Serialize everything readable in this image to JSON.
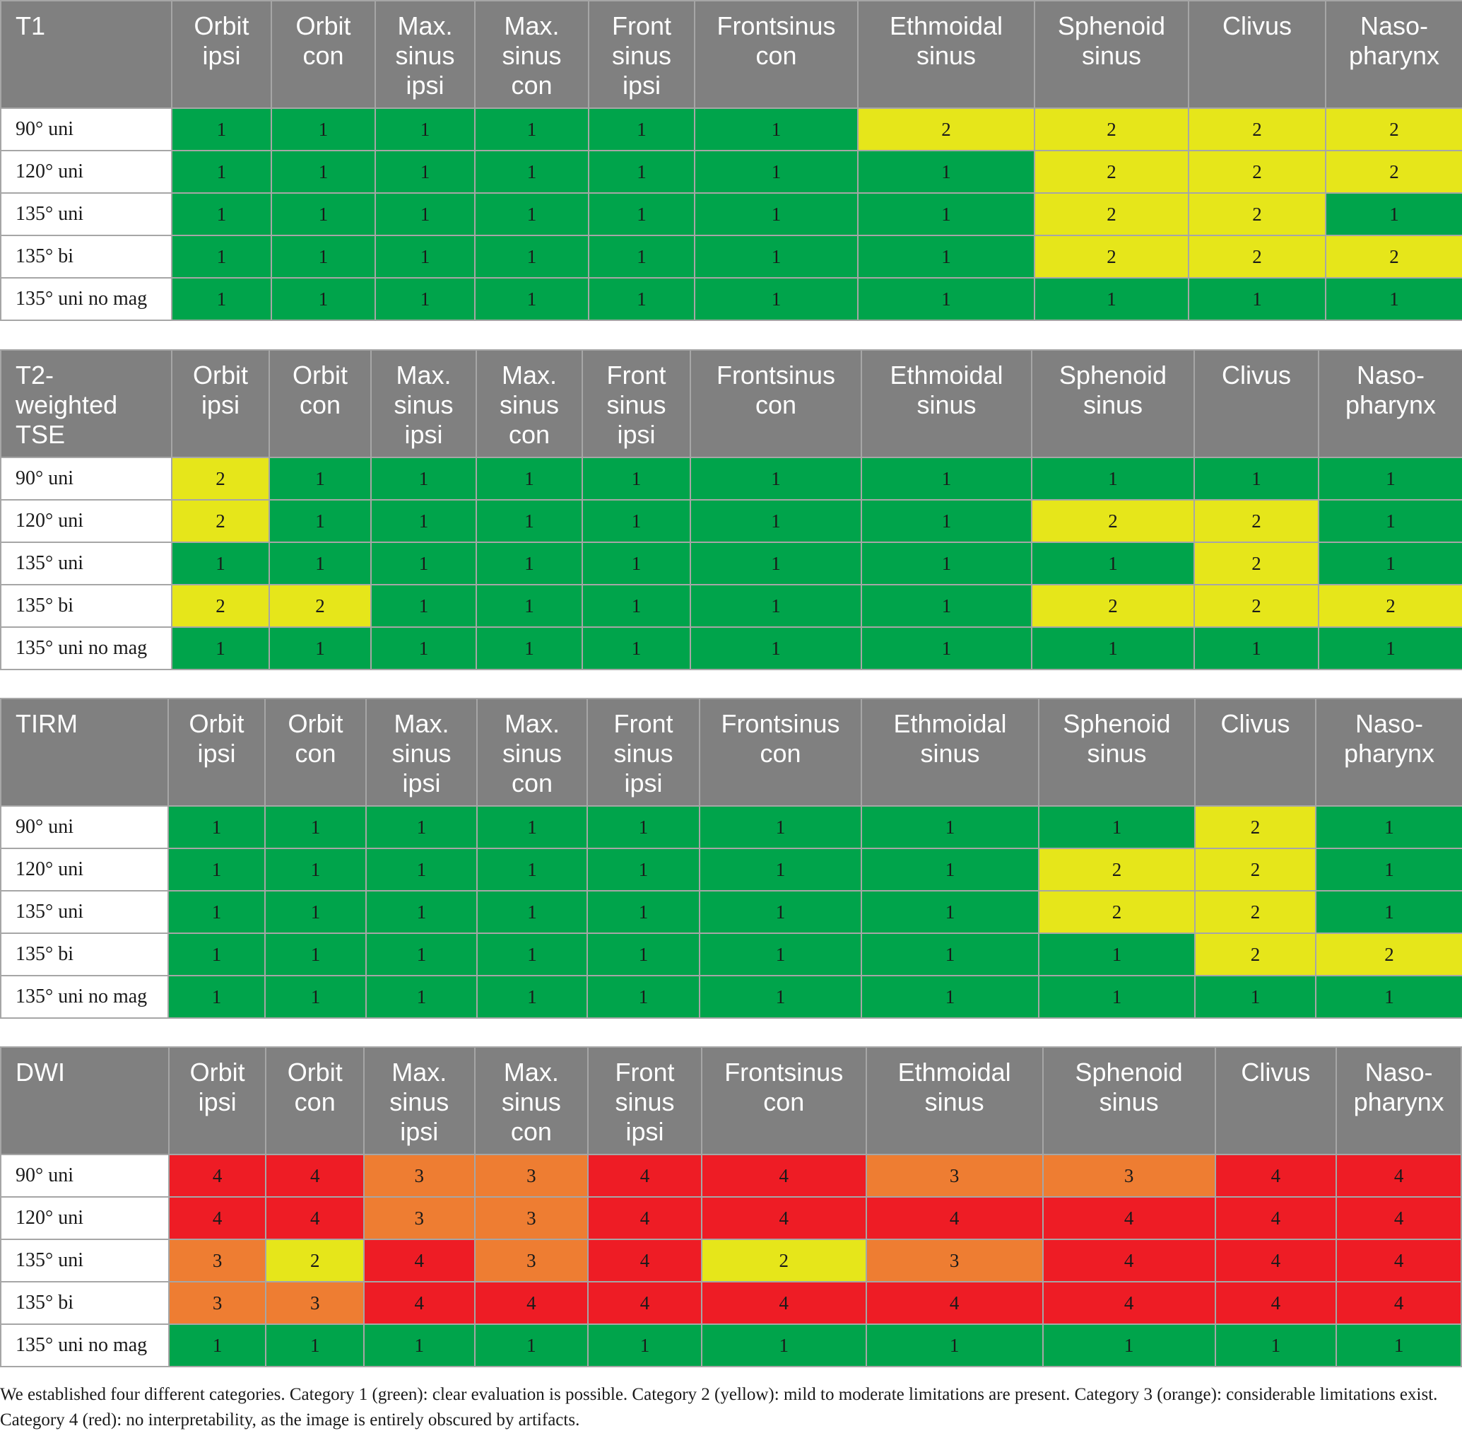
{
  "colors": {
    "1": "#00a44b",
    "2": "#e6e61a",
    "3": "#ee7d32",
    "4": "#ee1c25",
    "header": "#808080",
    "grid_line": "#a6a6a6"
  },
  "columns": [
    "Orbit\nipsi",
    "Orbit\ncon",
    "Max.\nsinus\nipsi",
    "Max.\nsinus\ncon",
    "Front\nsinus\nipsi",
    "Frontsinus\ncon",
    "Ethmoidal\nsinus",
    "Sphenoid\nsinus",
    "Clivus",
    "Naso-\npharynx"
  ],
  "row_labels": [
    "90° uni",
    "120° uni",
    "135° uni",
    "135° bi",
    "135° uni no mag"
  ],
  "tables": [
    {
      "title": "T1",
      "rows": [
        [
          "1",
          "1",
          "1",
          "1",
          "1",
          "1",
          "2",
          "2",
          "2",
          "2"
        ],
        [
          "1",
          "1",
          "1",
          "1",
          "1",
          "1",
          "1",
          "2",
          "2",
          "2"
        ],
        [
          "1",
          "1",
          "1",
          "1",
          "1",
          "1",
          "1",
          "2",
          "2",
          "1"
        ],
        [
          "1",
          "1",
          "1",
          "1",
          "1",
          "1",
          "1",
          "2",
          "2",
          "2"
        ],
        [
          "1",
          "1",
          "1",
          "1",
          "1",
          "1",
          "1",
          "1",
          "1",
          "1"
        ]
      ]
    },
    {
      "title": "T2-\nweighted\nTSE",
      "rows": [
        [
          "2",
          "1",
          "1",
          "1",
          "1",
          "1",
          "1",
          "1",
          "1",
          "1"
        ],
        [
          "2",
          "1",
          "1",
          "1",
          "1",
          "1",
          "1",
          "2",
          "2",
          "1"
        ],
        [
          "1",
          "1",
          "1",
          "1",
          "1",
          "1",
          "1",
          "1",
          "2",
          "1"
        ],
        [
          "2",
          "2",
          "1",
          "1",
          "1",
          "1",
          "1",
          "2",
          "2",
          "2"
        ],
        [
          "1",
          "1",
          "1",
          "1",
          "1",
          "1",
          "1",
          "1",
          "1",
          "1"
        ]
      ]
    },
    {
      "title": "TIRM",
      "rows": [
        [
          "1",
          "1",
          "1",
          "1",
          "1",
          "1",
          "1",
          "1",
          "2",
          "1"
        ],
        [
          "1",
          "1",
          "1",
          "1",
          "1",
          "1",
          "1",
          "2",
          "2",
          "1"
        ],
        [
          "1",
          "1",
          "1",
          "1",
          "1",
          "1",
          "1",
          "2",
          "2",
          "1"
        ],
        [
          "1",
          "1",
          "1",
          "1",
          "1",
          "1",
          "1",
          "1",
          "2",
          "2"
        ],
        [
          "1",
          "1",
          "1",
          "1",
          "1",
          "1",
          "1",
          "1",
          "1",
          "1"
        ]
      ]
    },
    {
      "title": "DWI",
      "rows": [
        [
          "4",
          "4",
          "3",
          "3",
          "4",
          "4",
          "3",
          "3",
          "4",
          "4"
        ],
        [
          "4",
          "4",
          "3",
          "3",
          "4",
          "4",
          "4",
          "4",
          "4",
          "4"
        ],
        [
          "3",
          "2",
          "4",
          "3",
          "4",
          "2",
          "3",
          "4",
          "4",
          "4"
        ],
        [
          "3",
          "3",
          "4",
          "4",
          "4",
          "4",
          "4",
          "4",
          "4",
          "4"
        ],
        [
          "1",
          "1",
          "1",
          "1",
          "1",
          "1",
          "1",
          "1",
          "1",
          "1"
        ]
      ]
    }
  ],
  "footnote": "We established four different categories. Category 1 (green): clear evaluation is possible. Category 2 (yellow): mild to moderate limitations are present. Category 3 (orange): considerable limitations exist. Category 4 (red): no interpretability, as the image is entirely obscured by artifacts."
}
